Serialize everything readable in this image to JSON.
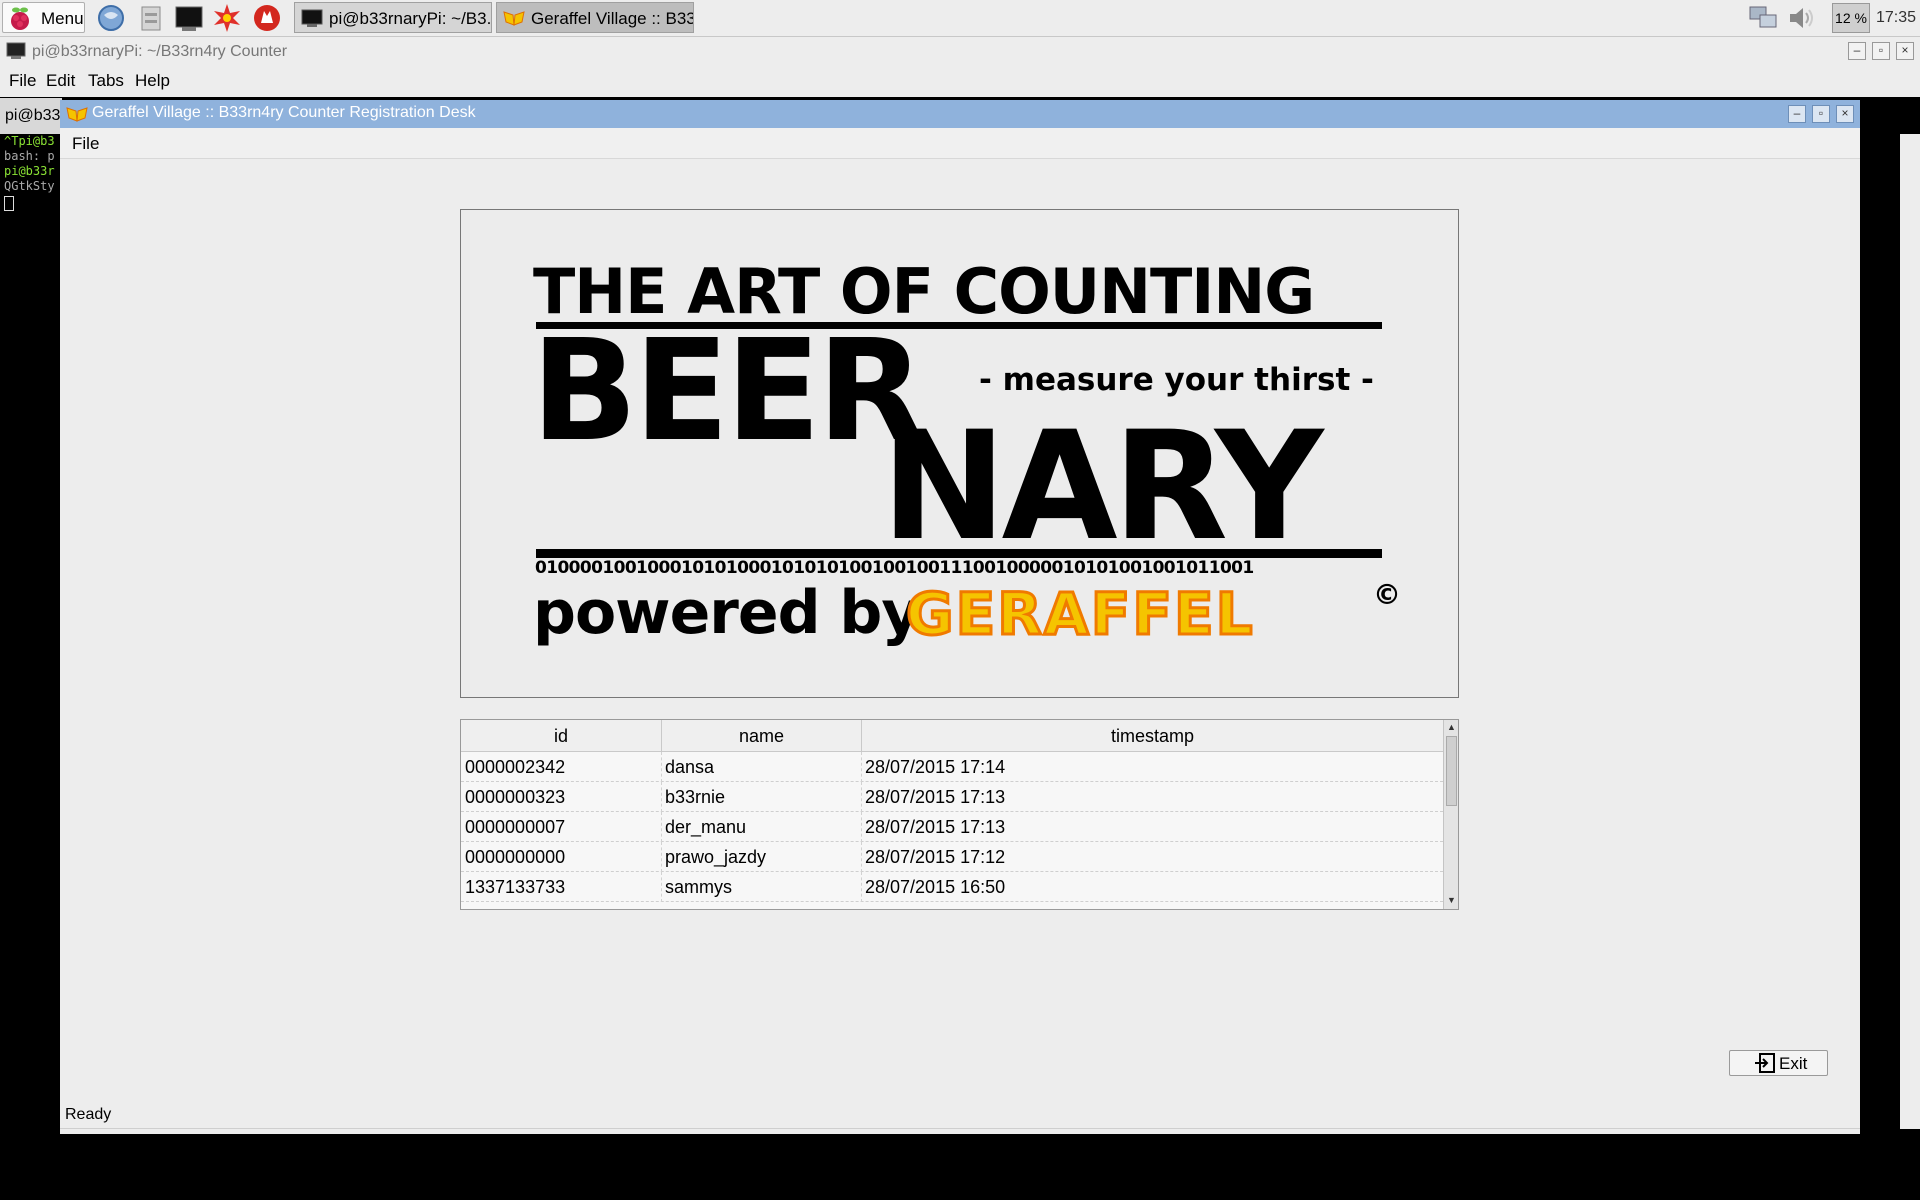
{
  "taskbar": {
    "menu_label": "Menu",
    "tasks": [
      {
        "label": "pi@b33rnaryPi: ~/B3...",
        "icon": "terminal-icon"
      },
      {
        "label": "Geraffel Village :: B33...",
        "icon": "geraffel-icon"
      }
    ],
    "launchers": [
      "browser-icon",
      "file-manager-icon",
      "terminal-icon",
      "math-icon",
      "wolfram-icon"
    ],
    "cpu_label": "12 %",
    "clock": "17:35"
  },
  "terminal": {
    "title": "pi@b33rnaryPi: ~/B33rn4ry Counter",
    "menu": [
      "File",
      "Edit",
      "Tabs",
      "Help"
    ],
    "tab_label": "pi@b33",
    "lines": [
      "^Tpi@b3",
      "bash: p",
      "pi@b33r",
      "QGtkSty"
    ]
  },
  "app": {
    "title": "Geraffel Village :: B33rn4ry Counter Registration Desk",
    "menu_file": "File",
    "logo": {
      "line1": "THE ART OF COUNTING",
      "word1": "BEER",
      "tagline": "- measure your thirst -",
      "word2": "NARY",
      "binary": "0100001001000101010001010101001001001110010000010101001001011001",
      "powered_by": "powered by",
      "brand": "GERAFFEL",
      "copyright": "©"
    },
    "table": {
      "headers": [
        "id",
        "name",
        "timestamp"
      ],
      "rows": [
        {
          "id": "0000002342",
          "name": "dansa",
          "timestamp": "28/07/2015 17:14"
        },
        {
          "id": "0000000323",
          "name": "b33rnie",
          "timestamp": "28/07/2015 17:13"
        },
        {
          "id": "0000000007",
          "name": "der_manu",
          "timestamp": "28/07/2015 17:13"
        },
        {
          "id": "0000000000",
          "name": "prawo_jazdy",
          "timestamp": "28/07/2015 17:12"
        },
        {
          "id": "1337133733",
          "name": "sammys",
          "timestamp": "28/07/2015 16:50"
        }
      ]
    },
    "exit_label": "Exit",
    "status": "Ready"
  },
  "colors": {
    "title_bar": "#8fb2dc",
    "brand_yellow": "#f5c400",
    "brand_orange": "#f07a00"
  }
}
